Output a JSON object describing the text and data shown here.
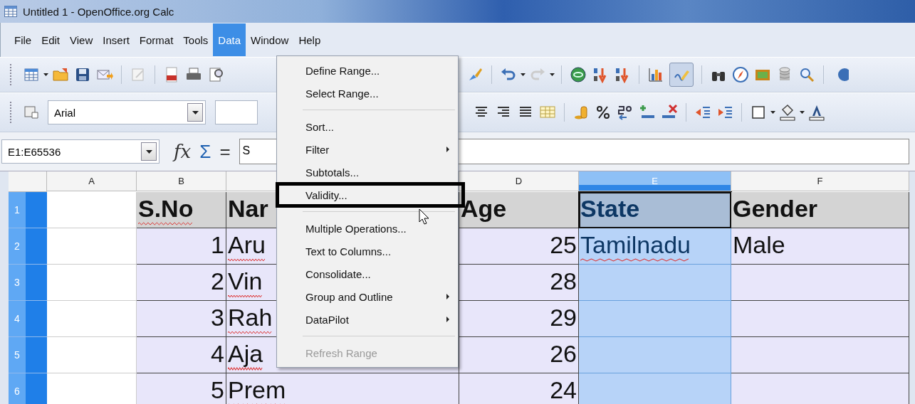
{
  "window": {
    "title": "Untitled 1 - OpenOffice.org Calc"
  },
  "menubar": [
    {
      "label": "File",
      "selected": false
    },
    {
      "label": "Edit",
      "selected": false
    },
    {
      "label": "View",
      "selected": false
    },
    {
      "label": "Insert",
      "selected": false
    },
    {
      "label": "Format",
      "selected": false
    },
    {
      "label": "Tools",
      "selected": false
    },
    {
      "label": "Data",
      "selected": true
    },
    {
      "label": "Window",
      "selected": false
    },
    {
      "label": "Help",
      "selected": false
    }
  ],
  "formatting": {
    "font_name": "Arial"
  },
  "formula_bar": {
    "name_box": "E1:E65536",
    "function_symbol": "fx",
    "sum_symbol": "Σ",
    "equals_symbol": "=",
    "value": "S"
  },
  "columns": [
    {
      "label": "A",
      "selected": false
    },
    {
      "label": "B",
      "selected": false
    },
    {
      "selected": false
    },
    {
      "label": "D",
      "selected": false
    },
    {
      "label": "E",
      "selected": true
    },
    {
      "label": "F",
      "selected": false
    }
  ],
  "rows": [
    {
      "number": "1",
      "selected": true,
      "kind": "header",
      "cells": [
        {
          "kind": "empty",
          "active": false
        },
        {
          "kind": "text",
          "text": "S.No",
          "misspelled": true,
          "active": false
        },
        {
          "kind": "text",
          "text": "Nar",
          "misspelled": false,
          "active": false
        },
        {
          "kind": "text",
          "text": "Age",
          "misspelled": false,
          "active": false
        },
        {
          "kind": "text",
          "text": "State",
          "misspelled": false,
          "active": true
        },
        {
          "kind": "text",
          "text": "Gender",
          "misspelled": false,
          "active": false
        }
      ]
    },
    {
      "number": "2",
      "selected": true,
      "kind": "data",
      "cells": [
        {
          "kind": "empty",
          "active": false
        },
        {
          "kind": "number",
          "text": "1",
          "active": false
        },
        {
          "kind": "text",
          "text": "Aru",
          "misspelled": true,
          "active": false
        },
        {
          "kind": "number",
          "text": "25",
          "active": false
        },
        {
          "kind": "text",
          "text": "Tamilnadu",
          "misspelled": true,
          "active": false
        },
        {
          "kind": "text",
          "text": "Male",
          "misspelled": false,
          "active": false
        }
      ]
    },
    {
      "number": "3",
      "selected": true,
      "kind": "data",
      "cells": [
        {
          "kind": "empty",
          "active": false
        },
        {
          "kind": "number",
          "text": "2",
          "active": false
        },
        {
          "kind": "text",
          "text": "Vin",
          "misspelled": true,
          "active": false
        },
        {
          "kind": "number",
          "text": "28",
          "active": false
        },
        {
          "kind": "empty",
          "active": false
        },
        {
          "kind": "empty",
          "active": false
        }
      ]
    },
    {
      "number": "4",
      "selected": true,
      "kind": "data",
      "cells": [
        {
          "kind": "empty",
          "active": false
        },
        {
          "kind": "number",
          "text": "3",
          "active": false
        },
        {
          "kind": "text",
          "text": "Rah",
          "misspelled": true,
          "active": false
        },
        {
          "kind": "number",
          "text": "29",
          "active": false
        },
        {
          "kind": "empty",
          "active": false
        },
        {
          "kind": "empty",
          "active": false
        }
      ]
    },
    {
      "number": "5",
      "selected": true,
      "kind": "data",
      "cells": [
        {
          "kind": "empty",
          "active": false
        },
        {
          "kind": "number",
          "text": "4",
          "active": false
        },
        {
          "kind": "text",
          "text": "Aja",
          "misspelled": true,
          "active": false
        },
        {
          "kind": "number",
          "text": "26",
          "active": false
        },
        {
          "kind": "empty",
          "active": false
        },
        {
          "kind": "empty",
          "active": false
        }
      ]
    },
    {
      "number": "6",
      "selected": true,
      "kind": "data",
      "cells": [
        {
          "kind": "empty",
          "active": false
        },
        {
          "kind": "number",
          "text": "5",
          "active": false
        },
        {
          "kind": "text",
          "text": "Prem",
          "misspelled": true,
          "active": false
        },
        {
          "kind": "number",
          "text": "24",
          "active": false
        },
        {
          "kind": "empty",
          "active": false
        },
        {
          "kind": "empty",
          "active": false
        }
      ]
    }
  ],
  "data_menu": [
    {
      "kind": "item",
      "label": "Define Range...",
      "disabled": false,
      "submenu": false,
      "outlined": false
    },
    {
      "kind": "item",
      "label": "Select Range...",
      "disabled": false,
      "submenu": false,
      "outlined": false
    },
    {
      "kind": "separator"
    },
    {
      "kind": "item",
      "label": "Sort...",
      "disabled": false,
      "submenu": false,
      "outlined": false
    },
    {
      "kind": "item",
      "label": "Filter",
      "disabled": false,
      "submenu": true,
      "outlined": false
    },
    {
      "kind": "item",
      "label": "Subtotals...",
      "disabled": false,
      "submenu": false,
      "outlined": false
    },
    {
      "kind": "item",
      "label": "Validity...",
      "disabled": false,
      "submenu": false,
      "outlined": true
    },
    {
      "kind": "separator"
    },
    {
      "kind": "item",
      "label": "Multiple Operations...",
      "disabled": false,
      "submenu": false,
      "outlined": false
    },
    {
      "kind": "item",
      "label": "Text to Columns...",
      "disabled": false,
      "submenu": false,
      "outlined": false
    },
    {
      "kind": "item",
      "label": "Consolidate...",
      "disabled": false,
      "submenu": false,
      "outlined": false
    },
    {
      "kind": "item",
      "label": "Group and Outline",
      "disabled": false,
      "submenu": true,
      "outlined": false
    },
    {
      "kind": "item",
      "label": "DataPilot",
      "disabled": false,
      "submenu": true,
      "outlined": false
    },
    {
      "kind": "separator"
    },
    {
      "kind": "item",
      "label": "Refresh Range",
      "disabled": true,
      "submenu": false,
      "outlined": false
    }
  ]
}
